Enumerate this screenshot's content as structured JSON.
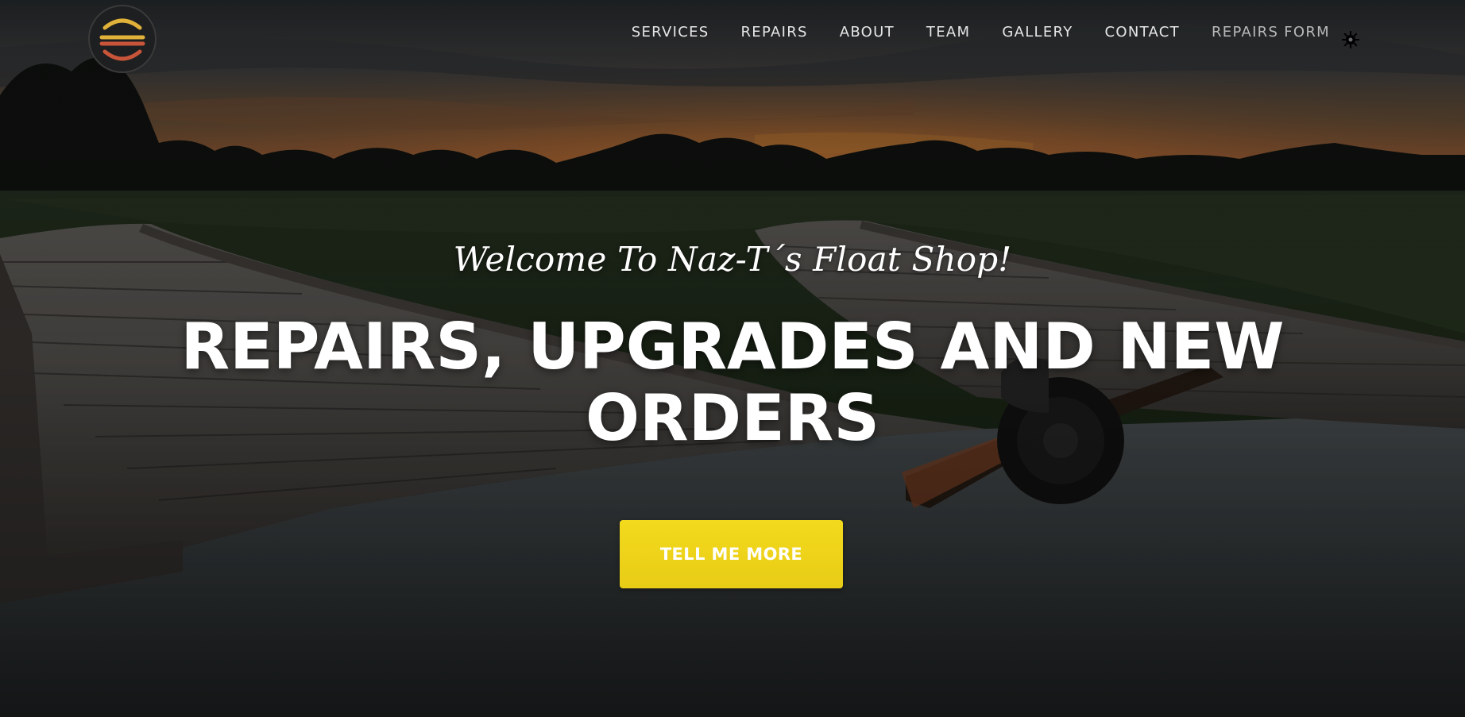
{
  "nav": {
    "items": [
      {
        "label": "SERVICES"
      },
      {
        "label": "REPAIRS"
      },
      {
        "label": "ABOUT"
      },
      {
        "label": "TEAM"
      },
      {
        "label": "GALLERY"
      },
      {
        "label": "CONTACT"
      },
      {
        "label": "REPAIRS FORM"
      }
    ],
    "theme_toggle_icon": "gear-sun-icon",
    "logo_icon": "float-shop-logo-icon"
  },
  "hero": {
    "subheading": "Welcome To Naz-T´s Float Shop!",
    "heading": "REPAIRS, UPGRADES AND NEW ORDERS",
    "cta_label": "TELL ME MORE"
  },
  "colors": {
    "accent": "#f0d51c",
    "nav_text": "#e6e6e6",
    "overlay": "#1b1d1f"
  }
}
